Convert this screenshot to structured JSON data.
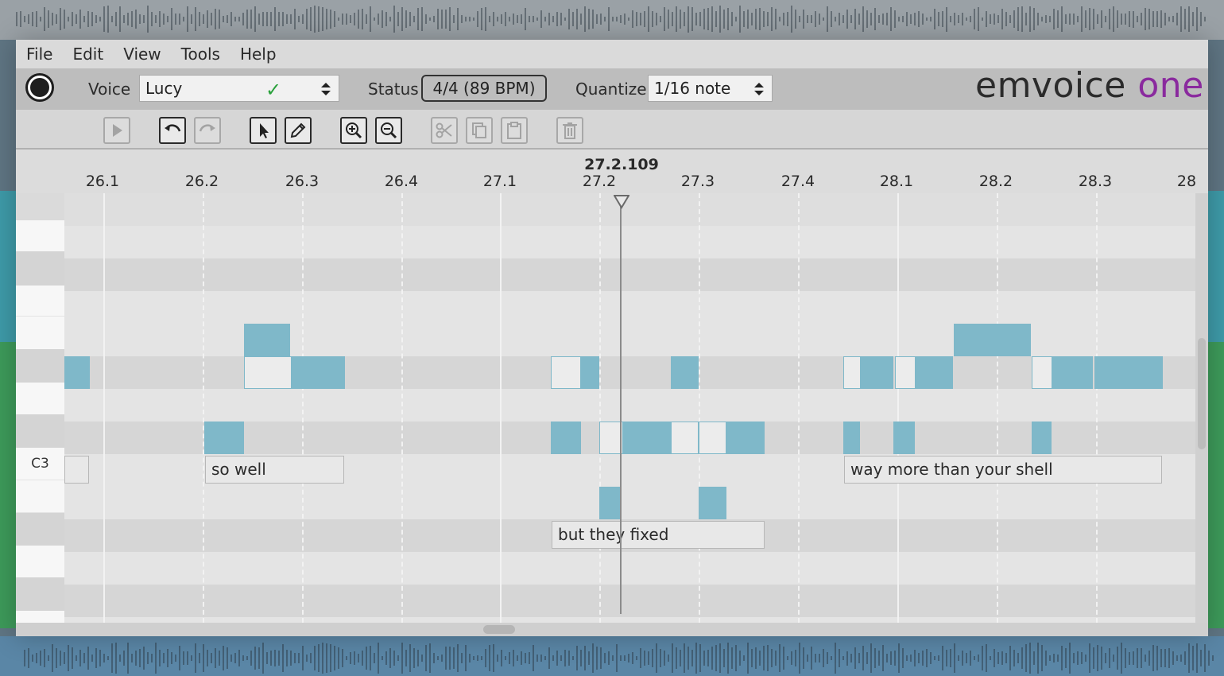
{
  "menu": [
    "File",
    "Edit",
    "View",
    "Tools",
    "Help"
  ],
  "voice": {
    "label": "Voice",
    "value": "Lucy",
    "status_icon": "check-icon"
  },
  "status": {
    "label": "Status",
    "value": "4/4 (89 BPM)"
  },
  "quantize": {
    "label": "Quantize",
    "value": "1/16 note"
  },
  "brand": {
    "part1": "emvoice",
    "part2": "one",
    "accent_color": "#8a2a9e"
  },
  "toolbar": {
    "buttons": [
      "play-icon",
      "undo-icon",
      "redo-icon",
      "select-arrow-icon",
      "pencil-icon",
      "zoom-in-icon",
      "zoom-out-icon",
      "cut-icon",
      "copy-icon",
      "paste-icon",
      "delete-icon"
    ]
  },
  "timeline": {
    "playhead_position": "27.2.109",
    "ticks": [
      "26.1",
      "26.2",
      "26.3",
      "26.4",
      "27.1",
      "27.2",
      "27.3",
      "27.4",
      "28.1",
      "28.2",
      "28.3",
      "28"
    ]
  },
  "piano": {
    "label": "C3"
  },
  "lyrics": [
    "so well",
    "but they fixed",
    "way more than your shell"
  ],
  "colors": {
    "note": "#7fb8c9",
    "window_bg": "#d9d9d9",
    "toolbar_bg": "#bdbdbd"
  }
}
